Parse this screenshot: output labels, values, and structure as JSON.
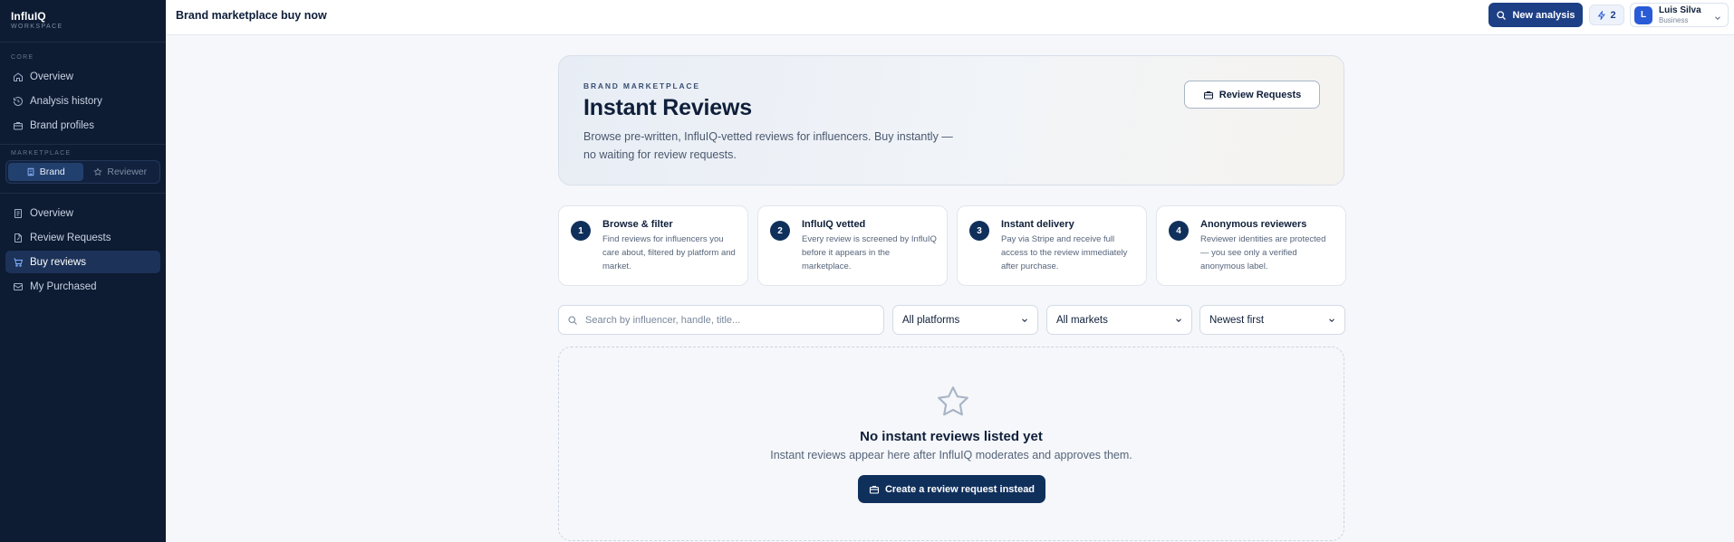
{
  "app": {
    "name": "InfluIQ",
    "sub": "WORKSPACE"
  },
  "sidebar": {
    "core_label": "CORE",
    "core_items": [
      {
        "label": "Overview",
        "icon": "home-icon"
      },
      {
        "label": "Analysis history",
        "icon": "history-icon"
      },
      {
        "label": "Brand profiles",
        "icon": "briefcase-icon"
      }
    ],
    "marketplace_label": "MARKETPLACE",
    "toggle": {
      "brand": "Brand",
      "reviewer": "Reviewer",
      "selected": "Brand"
    },
    "market_items": [
      {
        "label": "Overview",
        "icon": "document-icon"
      },
      {
        "label": "Review Requests",
        "icon": "edit-document-icon"
      },
      {
        "label": "Buy reviews",
        "icon": "cart-icon",
        "active": true
      },
      {
        "label": "My Purchased",
        "icon": "mail-icon"
      }
    ]
  },
  "header": {
    "title": "Brand marketplace buy now",
    "new_analysis": "New analysis",
    "credits": "2",
    "user_initial": "L",
    "user_name": "Luis Silva",
    "user_plan": "Business"
  },
  "hero": {
    "eyebrow": "BRAND MARKETPLACE",
    "title": "Instant Reviews",
    "description": "Browse pre-written, InfluIQ-vetted reviews for influencers. Buy instantly — no waiting for review requests.",
    "review_requests_button": "Review Requests"
  },
  "steps": [
    {
      "num": "1",
      "title": "Browse & filter",
      "desc": "Find reviews for influencers you care about, filtered by platform and market."
    },
    {
      "num": "2",
      "title": "InfluIQ vetted",
      "desc": "Every review is screened by InfluIQ before it appears in the marketplace."
    },
    {
      "num": "3",
      "title": "Instant delivery",
      "desc": "Pay via Stripe and receive full access to the review immediately after purchase."
    },
    {
      "num": "4",
      "title": "Anonymous reviewers",
      "desc": "Reviewer identities are protected — you see only a verified anonymous label."
    }
  ],
  "filters": {
    "search_placeholder": "Search by influencer, handle, title...",
    "search_value": "",
    "platform": "All platforms",
    "market": "All markets",
    "sort": "Newest first"
  },
  "empty": {
    "title": "No instant reviews listed yet",
    "desc": "Instant reviews appear here after InfluIQ moderates and approves them.",
    "button": "Create a review request instead"
  },
  "colors": {
    "sidebar_bg": "#0d1b33",
    "primary": "#1d3f86",
    "dark_primary": "#10305c"
  }
}
